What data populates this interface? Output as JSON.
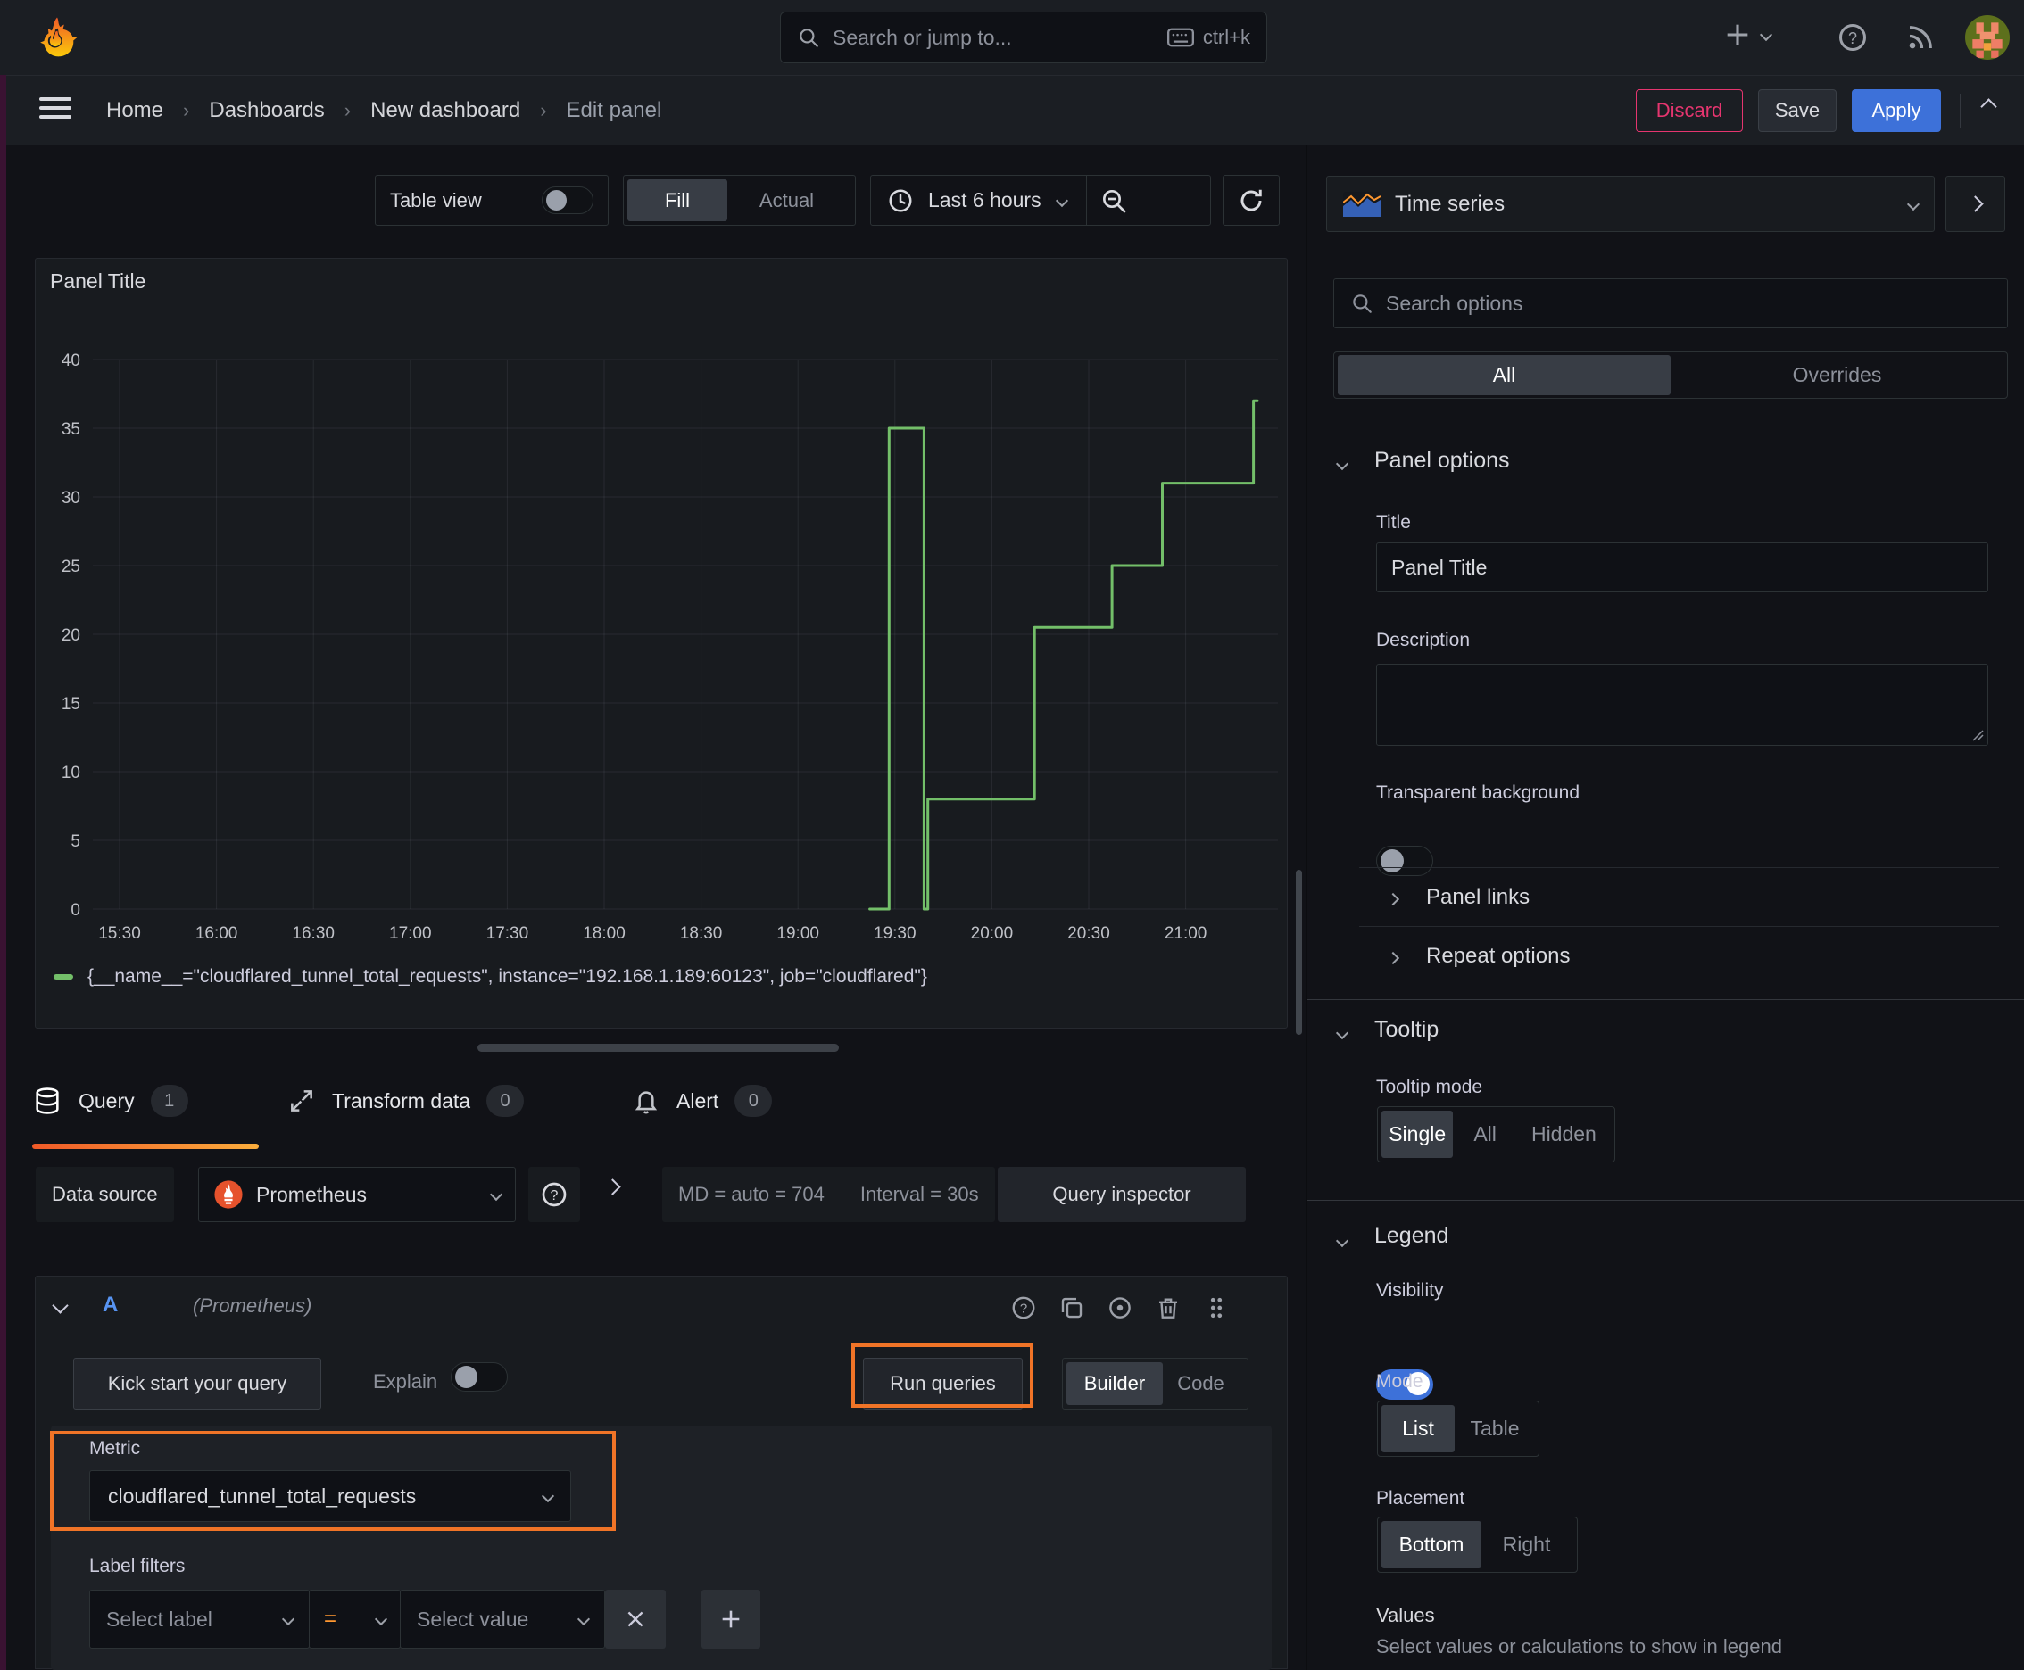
{
  "topbar": {
    "search_placeholder": "Search or jump to...",
    "shortcut": "ctrl+k"
  },
  "breadcrumb": {
    "items": [
      "Home",
      "Dashboards",
      "New dashboard",
      "Edit panel"
    ]
  },
  "header_actions": {
    "discard": "Discard",
    "save": "Save",
    "apply": "Apply"
  },
  "panel_toolbar": {
    "table_view_label": "Table view",
    "fill_label": "Fill",
    "actual_label": "Actual",
    "time_range_label": "Last 6 hours"
  },
  "panel": {
    "title": "Panel Title"
  },
  "chart_data": {
    "type": "line",
    "title": "Panel Title",
    "x_ticks": [
      "15:30",
      "16:00",
      "16:30",
      "17:00",
      "17:30",
      "18:00",
      "18:30",
      "19:00",
      "19:30",
      "20:00",
      "20:30",
      "21:00"
    ],
    "y_ticks": [
      0,
      5,
      10,
      15,
      20,
      25,
      30,
      35,
      40
    ],
    "ylim": [
      0,
      40
    ],
    "xlim_hours": [
      15.32,
      21.47
    ],
    "grid": true,
    "legend_position": "bottom",
    "series": [
      {
        "name": "{__name__=\"cloudflared_tunnel_total_requests\", instance=\"192.168.1.189:60123\", job=\"cloudflared\"}",
        "color": "#73bf69",
        "step": true,
        "points_time_value": [
          [
            19.37,
            0
          ],
          [
            19.47,
            0
          ],
          [
            19.47,
            35
          ],
          [
            19.65,
            35
          ],
          [
            19.65,
            0
          ],
          [
            19.67,
            0
          ],
          [
            19.67,
            8
          ],
          [
            20.22,
            8
          ],
          [
            20.22,
            20.5
          ],
          [
            20.62,
            20.5
          ],
          [
            20.62,
            25
          ],
          [
            20.88,
            25
          ],
          [
            20.88,
            31
          ],
          [
            21.35,
            31
          ],
          [
            21.35,
            37
          ],
          [
            21.37,
            37
          ]
        ]
      }
    ]
  },
  "editor_tabs": {
    "query": {
      "label": "Query",
      "badge": "1"
    },
    "transform": {
      "label": "Transform data",
      "badge": "0"
    },
    "alert": {
      "label": "Alert",
      "badge": "0"
    }
  },
  "datasource_bar": {
    "label": "Data source",
    "name": "Prometheus",
    "stats": "MD = auto = 704",
    "interval": "Interval = 30s",
    "inspector_label": "Query inspector"
  },
  "query_row": {
    "ref_id": "A",
    "hint": "(Prometheus)"
  },
  "query_controls": {
    "kick_start": "Kick start your query",
    "explain": "Explain",
    "run_queries": "Run queries",
    "builder": "Builder",
    "code": "Code"
  },
  "builder": {
    "metric_label": "Metric",
    "metric_value": "cloudflared_tunnel_total_requests",
    "label_filters_label": "Label filters",
    "select_label_placeholder": "Select label",
    "operator": "=",
    "select_value_placeholder": "Select value"
  },
  "sidebar": {
    "visualization": {
      "name": "Time series"
    },
    "search_placeholder": "Search options",
    "filter_tabs": {
      "all": "All",
      "overrides": "Overrides"
    },
    "panel_options": {
      "header": "Panel options",
      "title_label": "Title",
      "title_value": "Panel Title",
      "description_label": "Description",
      "transparent_label": "Transparent background"
    },
    "panel_links": {
      "header": "Panel links"
    },
    "repeat_options": {
      "header": "Repeat options"
    },
    "tooltip": {
      "header": "Tooltip",
      "mode_label": "Tooltip mode",
      "single": "Single",
      "all": "All",
      "hidden": "Hidden"
    },
    "legend": {
      "header": "Legend",
      "visibility_label": "Visibility",
      "mode_label": "Mode",
      "list": "List",
      "table": "Table",
      "placement_label": "Placement",
      "bottom": "Bottom",
      "right": "Right",
      "values_label": "Values",
      "values_help": "Select values or calculations to show in legend"
    }
  },
  "colors": {
    "accent_orange": "#f07427",
    "series_green": "#73bf69",
    "apply_blue": "#3d71d9",
    "discard_pink": "#e5356f"
  }
}
